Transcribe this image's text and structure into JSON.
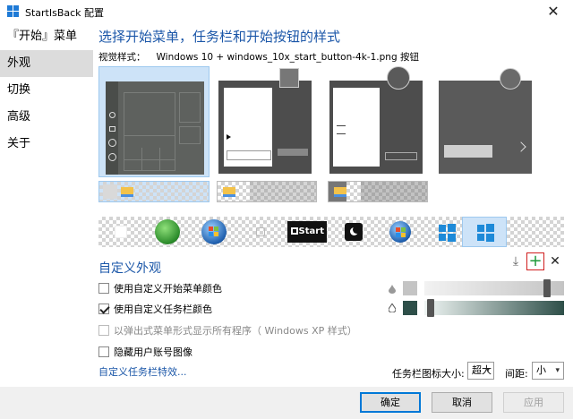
{
  "window": {
    "title": "StartIsBack 配置",
    "close_glyph": "✕"
  },
  "sidebar": {
    "items": [
      {
        "label": "『开始』菜单",
        "selected": false
      },
      {
        "label": "外观",
        "selected": true
      },
      {
        "label": "切换",
        "selected": false
      },
      {
        "label": "高级",
        "selected": false
      },
      {
        "label": "关于",
        "selected": false
      }
    ]
  },
  "main": {
    "heading": "选择开始菜单，任务栏和开始按钮的样式",
    "visual_style_label": "视觉样式：",
    "visual_style_value": "Windows 10 + windows_10x_start_button-4k-1.png 按钮",
    "start_styles": [
      "windows-10-style",
      "windows-7-light-style",
      "windows-7-dark-style",
      "windows-10-dark-style"
    ],
    "selected_start_style": 0,
    "taskbar_styles": [
      "taskbar-style-1",
      "taskbar-style-2",
      "taskbar-style-3"
    ],
    "selected_taskbar_style": 0,
    "orbs": [
      "blank-orb",
      "green-orb",
      "vista-orb",
      "outline-orb",
      "start-text-orb",
      "moon-orb",
      "win7-small-orb",
      "win10-blue-orb",
      "win10-4k-orb"
    ],
    "selected_orb": 8,
    "orb_start_text": "Start",
    "custom_heading": "自定义外观",
    "tools": {
      "download_glyph": "⤓",
      "add_glyph": "+",
      "remove_glyph": "✕"
    },
    "options": [
      {
        "label": "使用自定义开始菜单颜色",
        "checked": false,
        "enabled": true
      },
      {
        "label": "使用自定义任务栏颜色",
        "checked": true,
        "enabled": true
      },
      {
        "label": "以弹出式菜单形式显示所有程序（ Windows XP 样式）",
        "checked": false,
        "enabled": false
      },
      {
        "label": "隐藏用户账号图像",
        "checked": false,
        "enabled": true
      }
    ],
    "colors": {
      "start_menu_swatch": "#c4c4c4",
      "taskbar_swatch": "#2e4f49",
      "accent": "#1a56a8",
      "selection": "#cde3f8"
    },
    "start_menu_transparency": 0.9,
    "taskbar_transparency": 0.02,
    "customize_link": "自定义任务栏特效...",
    "icon_size_label": "任务栏图标大小:",
    "icon_size_value": "超大",
    "spacing_label": "间距:",
    "spacing_value": "小"
  },
  "footer": {
    "ok": "确定",
    "cancel": "取消",
    "apply": "应用"
  }
}
